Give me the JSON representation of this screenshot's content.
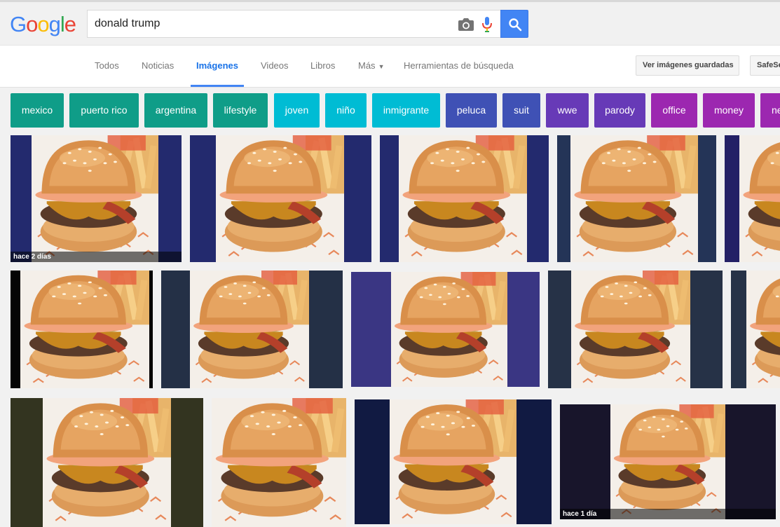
{
  "logo": {
    "letters": [
      "G",
      "o",
      "o",
      "g",
      "l",
      "e"
    ],
    "colors": [
      "#4285f4",
      "#ea4335",
      "#fbbc05",
      "#4285f4",
      "#34a853",
      "#ea4335"
    ]
  },
  "search": {
    "query": "donald trump"
  },
  "nav": {
    "tabs": [
      {
        "label": "Todos",
        "active": false
      },
      {
        "label": "Noticias",
        "active": false
      },
      {
        "label": "Imágenes",
        "active": true
      },
      {
        "label": "Videos",
        "active": false
      },
      {
        "label": "Libros",
        "active": false
      },
      {
        "label": "Más",
        "active": false
      },
      {
        "label": "Herramientas de búsqueda",
        "active": false
      }
    ],
    "saved_images_label": "Ver imágenes guardadas",
    "safesearch_label": "SafeSe"
  },
  "chips": [
    {
      "label": "mexico",
      "color": "#0f9d88"
    },
    {
      "label": "puerto rico",
      "color": "#0f9d88"
    },
    {
      "label": "argentina",
      "color": "#0f9d88"
    },
    {
      "label": "lifestyle",
      "color": "#0f9d88"
    },
    {
      "label": "joven",
      "color": "#00bcd4"
    },
    {
      "label": "niño",
      "color": "#00bcd4"
    },
    {
      "label": "inmigrante",
      "color": "#00bcd4"
    },
    {
      "label": "peluca",
      "color": "#3f51b5"
    },
    {
      "label": "suit",
      "color": "#3f51b5"
    },
    {
      "label": "wwe",
      "color": "#673ab7"
    },
    {
      "label": "parody",
      "color": "#673ab7"
    },
    {
      "label": "office",
      "color": "#9c27b0"
    },
    {
      "label": "money",
      "color": "#9c27b0"
    },
    {
      "label": "ne",
      "color": "#9c27b0"
    }
  ],
  "results": [
    {
      "pad_color": "#232a6e",
      "badge": "hace 2 días"
    },
    {
      "pad_color": "#232a6e",
      "badge": ""
    },
    {
      "pad_color": "#232a6e",
      "badge": ""
    },
    {
      "pad_color": "#243457",
      "badge": ""
    },
    {
      "pad_color": "#232066",
      "badge": ""
    },
    {
      "pad_color": "#050505",
      "badge": ""
    },
    {
      "pad_color": "#243046",
      "badge": ""
    },
    {
      "pad_color": "#3a3683",
      "badge": ""
    },
    {
      "pad_color": "#263247",
      "badge": ""
    },
    {
      "pad_color": "#263247",
      "badge": ""
    },
    {
      "pad_color": "#333420",
      "badge": ""
    },
    {
      "pad_color": "#f1f1f1",
      "badge": ""
    },
    {
      "pad_color": "#111a42",
      "badge": ""
    },
    {
      "pad_color": "#18152b",
      "badge": "hace 1 día"
    }
  ]
}
